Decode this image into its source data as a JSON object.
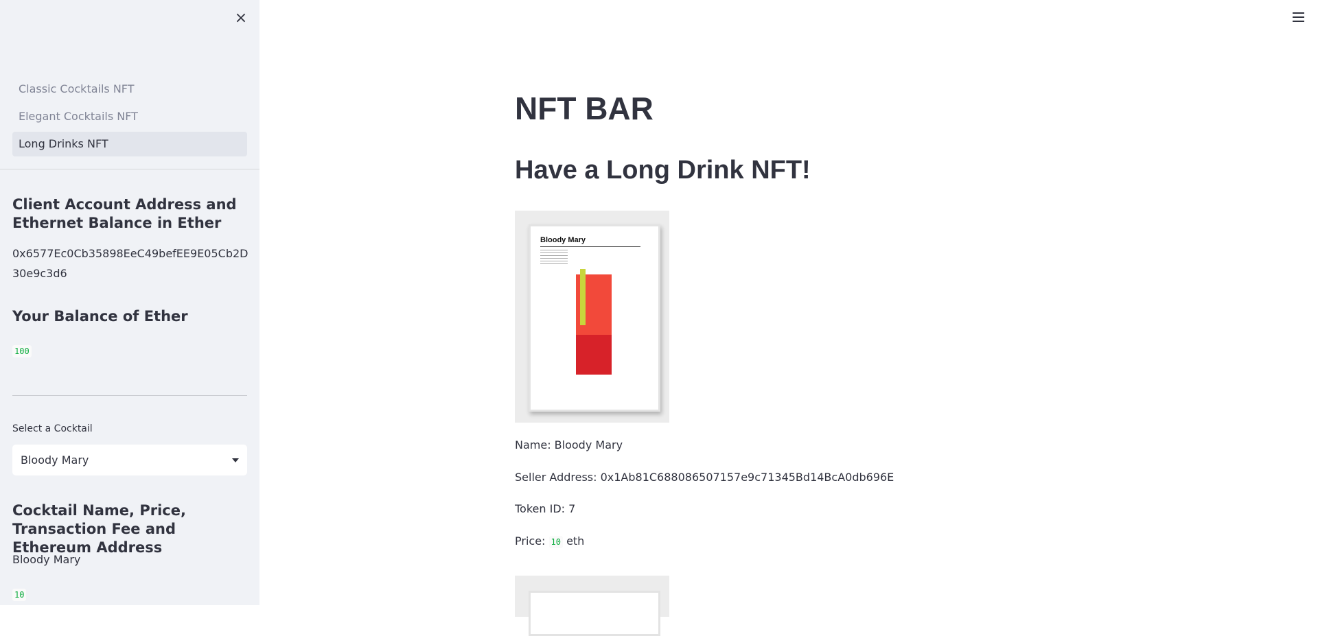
{
  "sidebar": {
    "close_icon": "×",
    "nav": [
      {
        "label": "Classic Cocktails NFT",
        "active": false
      },
      {
        "label": "Elegant Cocktails NFT",
        "active": false
      },
      {
        "label": "Long Drinks NFT",
        "active": true
      }
    ],
    "account_heading": "Client Account Address and Ethernet Balance in Ether",
    "account_address": "0x6577Ec0Cb35898EeC49befEE9E05Cb2D30e9c3d6",
    "balance_heading": "Your Balance of Ether",
    "balance_value": "100",
    "select_label": "Select a Cocktail",
    "select_value": "Bloody Mary",
    "details_heading": "Cocktail Name, Price, Transaction Fee and Ethereum Address",
    "details_name": "Bloody Mary",
    "details_price": "10"
  },
  "main": {
    "title": "NFT BAR",
    "subtitle": "Have a Long Drink NFT!",
    "nft": {
      "poster_title": "Bloody Mary",
      "name_line": "Name: Bloody Mary",
      "seller_line": "Seller Address: 0x1Ab81C688086507157e9c71345Bd14BcA0db696E",
      "token_line": "Token ID: 7",
      "price_prefix": "Price:",
      "price_value": "10",
      "price_unit": "eth"
    }
  },
  "colors": {
    "sidebar_bg": "#f0f2f6",
    "code_green": "#09ab3b",
    "text": "#31333f"
  },
  "icons": {
    "close": "close-icon",
    "menu": "hamburger-menu-icon",
    "dropdown": "chevron-down-icon"
  }
}
